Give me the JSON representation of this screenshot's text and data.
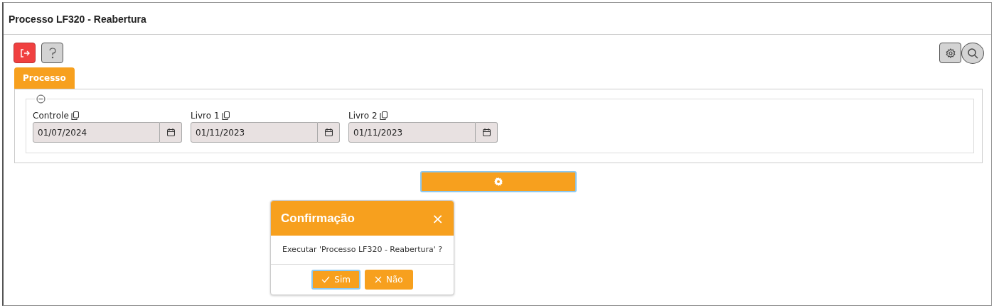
{
  "window": {
    "title": "Processo LF320 - Reabertura"
  },
  "tabs": [
    {
      "label": "Processo",
      "selected": true
    }
  ],
  "group": {
    "expanded": true,
    "fields": [
      {
        "label": "Controle",
        "value": "01/07/2024"
      },
      {
        "label": "Livro 1",
        "value": "01/11/2023"
      },
      {
        "label": "Livro 2",
        "value": "01/11/2023"
      }
    ]
  },
  "dialog": {
    "title": "Confirmação",
    "close": "×",
    "message": "Executar 'Processo LF320 - Reabertura' ?",
    "buttons": [
      {
        "kind": "confirm",
        "label": "Sim",
        "focused": true
      },
      {
        "kind": "cancel",
        "label": "Não",
        "focused": false
      }
    ]
  }
}
